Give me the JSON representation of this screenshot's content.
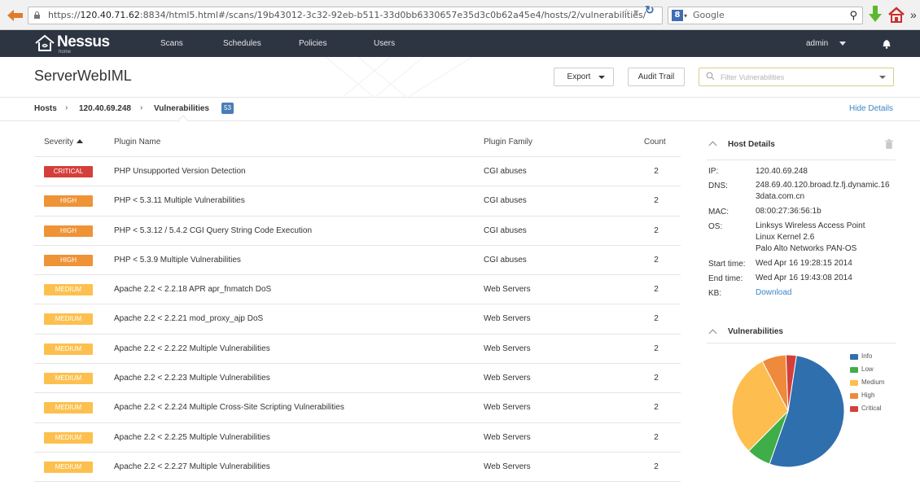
{
  "browser": {
    "url_prefix": "https://",
    "url_host": "120.40.71.62",
    "url_rest": ":8834/html5.html#/scans/19b43012-3c32-92eb-b511-33d0bb6330657e35d3c0b62a45e4/hosts/2/vulnerabilities/",
    "search_engine_placeholder": "Google"
  },
  "navbar": {
    "logo_text": "Nessus",
    "logo_sub": "home",
    "items": [
      {
        "label": "Scans"
      },
      {
        "label": "Schedules"
      },
      {
        "label": "Policies"
      },
      {
        "label": "Users"
      }
    ],
    "user": "admin"
  },
  "header": {
    "title": "ServerWebIML",
    "export_label": "Export",
    "audit_label": "Audit Trail",
    "filter_placeholder": "Filter Vulnerabilities"
  },
  "breadcrumb": {
    "hosts": "Hosts",
    "host_ip": "120.40.69.248",
    "current": "Vulnerabilities",
    "count": "53",
    "hide_details": "Hide Details"
  },
  "table": {
    "columns": {
      "severity": "Severity",
      "plugin": "Plugin Name",
      "family": "Plugin Family",
      "count": "Count"
    },
    "rows": [
      {
        "severity": "CRITICAL",
        "level": "critical",
        "plugin": "PHP Unsupported Version Detection",
        "family": "CGI abuses",
        "count": "2"
      },
      {
        "severity": "HIGH",
        "level": "high",
        "plugin": "PHP < 5.3.11 Multiple Vulnerabilities",
        "family": "CGI abuses",
        "count": "2"
      },
      {
        "severity": "HIGH",
        "level": "high",
        "plugin": "PHP < 5.3.12 / 5.4.2 CGI Query String Code Execution",
        "family": "CGI abuses",
        "count": "2"
      },
      {
        "severity": "HIGH",
        "level": "high",
        "plugin": "PHP < 5.3.9 Multiple Vulnerabilities",
        "family": "CGI abuses",
        "count": "2"
      },
      {
        "severity": "MEDIUM",
        "level": "medium",
        "plugin": "Apache 2.2 < 2.2.18 APR apr_fnmatch DoS",
        "family": "Web Servers",
        "count": "2"
      },
      {
        "severity": "MEDIUM",
        "level": "medium",
        "plugin": "Apache 2.2 < 2.2.21 mod_proxy_ajp DoS",
        "family": "Web Servers",
        "count": "2"
      },
      {
        "severity": "MEDIUM",
        "level": "medium",
        "plugin": "Apache 2.2 < 2.2.22 Multiple Vulnerabilities",
        "family": "Web Servers",
        "count": "2"
      },
      {
        "severity": "MEDIUM",
        "level": "medium",
        "plugin": "Apache 2.2 < 2.2.23 Multiple Vulnerabilities",
        "family": "Web Servers",
        "count": "2"
      },
      {
        "severity": "MEDIUM",
        "level": "medium",
        "plugin": "Apache 2.2 < 2.2.24 Multiple Cross-Site Scripting Vulnerabilities",
        "family": "Web Servers",
        "count": "2"
      },
      {
        "severity": "MEDIUM",
        "level": "medium",
        "plugin": "Apache 2.2 < 2.2.25 Multiple Vulnerabilities",
        "family": "Web Servers",
        "count": "2"
      },
      {
        "severity": "MEDIUM",
        "level": "medium",
        "plugin": "Apache 2.2 < 2.2.27 Multiple Vulnerabilities",
        "family": "Web Servers",
        "count": "2"
      }
    ]
  },
  "host_details": {
    "title": "Host Details",
    "ip_label": "IP:",
    "ip": "120.40.69.248",
    "dns_label": "DNS:",
    "dns_line1": "248.69.40.120.broad.fz.fj.dynamic.16",
    "dns_line2": "3data.com.cn",
    "mac_label": "MAC:",
    "mac": "08:00:27:36:56:1b",
    "os_label": "OS:",
    "os_line1": "Linksys Wireless Access Point",
    "os_line2": "Linux Kernel 2.6",
    "os_line3": "Palo Alto Networks PAN-OS",
    "start_label": "Start time:",
    "start": "Wed Apr 16 19:28:15 2014",
    "end_label": "End time:",
    "end": "Wed Apr 16 19:43:08 2014",
    "kb_label": "KB:",
    "kb": "Download"
  },
  "vulnerabilities_panel": {
    "title": "Vulnerabilities"
  },
  "chart_data": {
    "type": "pie",
    "categories": [
      "Info",
      "Low",
      "Medium",
      "High",
      "Critical"
    ],
    "values": [
      53,
      7,
      30,
      7,
      3
    ],
    "colors": [
      "#2f6fad",
      "#3fae49",
      "#fdbd4f",
      "#ef8a3c",
      "#d43f3a"
    ]
  },
  "colors": {
    "critical": "#d43f3a",
    "high": "#ee9336",
    "medium": "#fdc04e",
    "link": "#3b86c6",
    "navbar": "#2e3542"
  }
}
